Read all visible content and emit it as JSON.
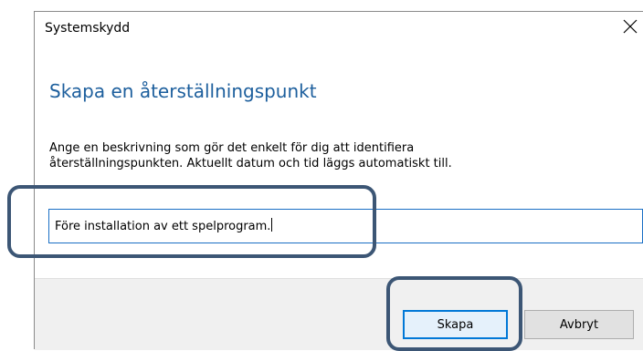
{
  "window": {
    "title": "Systemskydd",
    "close_glyph": "close-icon"
  },
  "main": {
    "heading": "Skapa en återställningspunkt",
    "description_line1": "Ange en beskrivning som gör det enkelt för dig att identifiera",
    "description_line2": "återställningspunkten. Aktuellt datum och tid läggs automatiskt till.",
    "input_value": "Före installation av ett spelprogram."
  },
  "buttons": {
    "create_label": "Skapa",
    "cancel_label": "Avbryt"
  },
  "colors": {
    "heading": "#1d5f9d",
    "focus_border": "#0078d7",
    "annotation": "#3c5675"
  }
}
